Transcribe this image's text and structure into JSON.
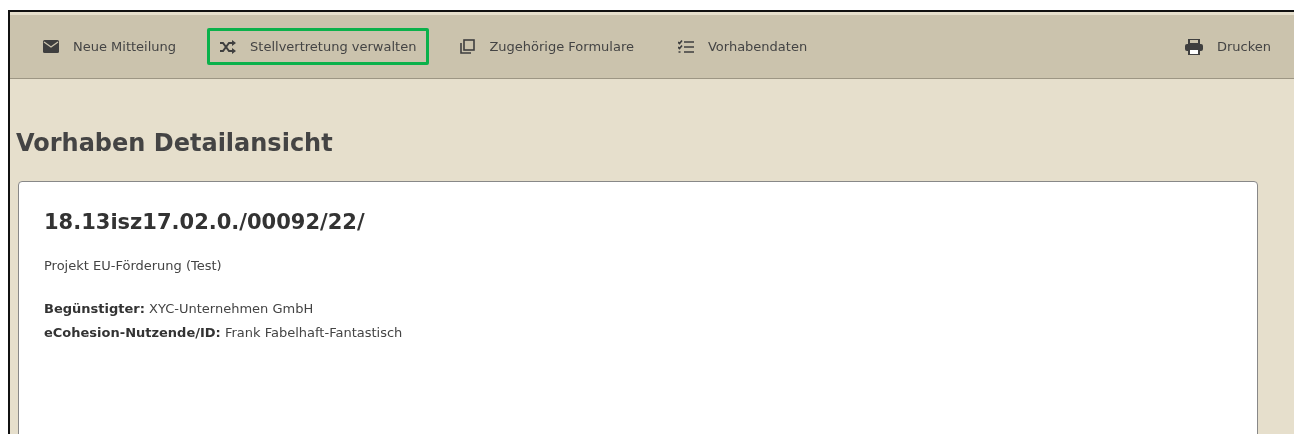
{
  "toolbar": {
    "items": [
      {
        "label": "Neue Mitteilung",
        "highlighted": false
      },
      {
        "label": "Stellvertretung verwalten",
        "highlighted": true
      },
      {
        "label": "Zugehörige Formulare",
        "highlighted": false
      },
      {
        "label": "Vorhabendaten",
        "highlighted": false
      }
    ],
    "print_button": {
      "label": "Drucken"
    }
  },
  "page_title": "Vorhaben Detailansicht",
  "card": {
    "number": "18.13isz17.02.0./00092/22/",
    "description": "Projekt EU-Förderung (Test)",
    "fields": [
      "**Begünstigter:** XYC-Unternehmen GmbH",
      "**eCohesion-Nutzende/ID:** Frank Fabelhaft-Fantastisch"
    ]
  }
}
